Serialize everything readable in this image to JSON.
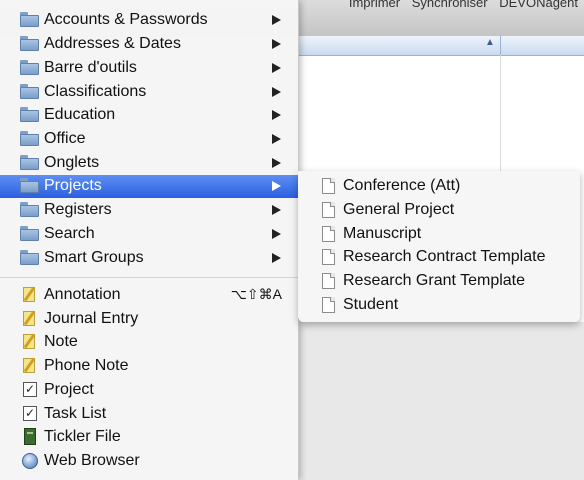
{
  "toolbar": {
    "items": [
      "Imprimer",
      "Synchroniser",
      "DEVONagent"
    ]
  },
  "menu": {
    "groups": [
      {
        "label": "Accounts & Passwords",
        "icon": "folder-icon"
      },
      {
        "label": "Addresses & Dates",
        "icon": "folder-icon"
      },
      {
        "label": "Barre d'outils",
        "icon": "folder-icon"
      },
      {
        "label": "Classifications",
        "icon": "folder-icon"
      },
      {
        "label": "Education",
        "icon": "folder-icon"
      },
      {
        "label": "Office",
        "icon": "folder-icon"
      },
      {
        "label": "Onglets",
        "icon": "folder-icon"
      },
      {
        "label": "Projects",
        "icon": "folder-icon",
        "highlighted": true
      },
      {
        "label": "Registers",
        "icon": "folder-icon"
      },
      {
        "label": "Search",
        "icon": "folder-icon"
      },
      {
        "label": "Smart Groups",
        "icon": "folder-icon"
      }
    ],
    "items": [
      {
        "label": "Annotation",
        "icon": "note-icon",
        "shortcut": "⌥⇧⌘A"
      },
      {
        "label": "Journal Entry",
        "icon": "note-icon"
      },
      {
        "label": "Note",
        "icon": "note-icon"
      },
      {
        "label": "Phone Note",
        "icon": "note-icon"
      },
      {
        "label": "Project",
        "icon": "checkbox-icon"
      },
      {
        "label": "Task List",
        "icon": "checkbox-icon"
      },
      {
        "label": "Tickler File",
        "icon": "tickler-icon"
      },
      {
        "label": "Web Browser",
        "icon": "globe-icon"
      }
    ]
  },
  "submenu": {
    "items": [
      {
        "label": "Conference (Att)",
        "icon": "document-icon"
      },
      {
        "label": "General Project",
        "icon": "document-icon"
      },
      {
        "label": "Manuscript",
        "icon": "document-icon"
      },
      {
        "label": "Research Contract Template",
        "icon": "document-icon"
      },
      {
        "label": "Research Grant Template",
        "icon": "document-icon"
      },
      {
        "label": "Student",
        "icon": "document-icon"
      }
    ]
  },
  "colors": {
    "highlight": "#3a6cf0",
    "menu_bg": "#f5f5f5"
  }
}
